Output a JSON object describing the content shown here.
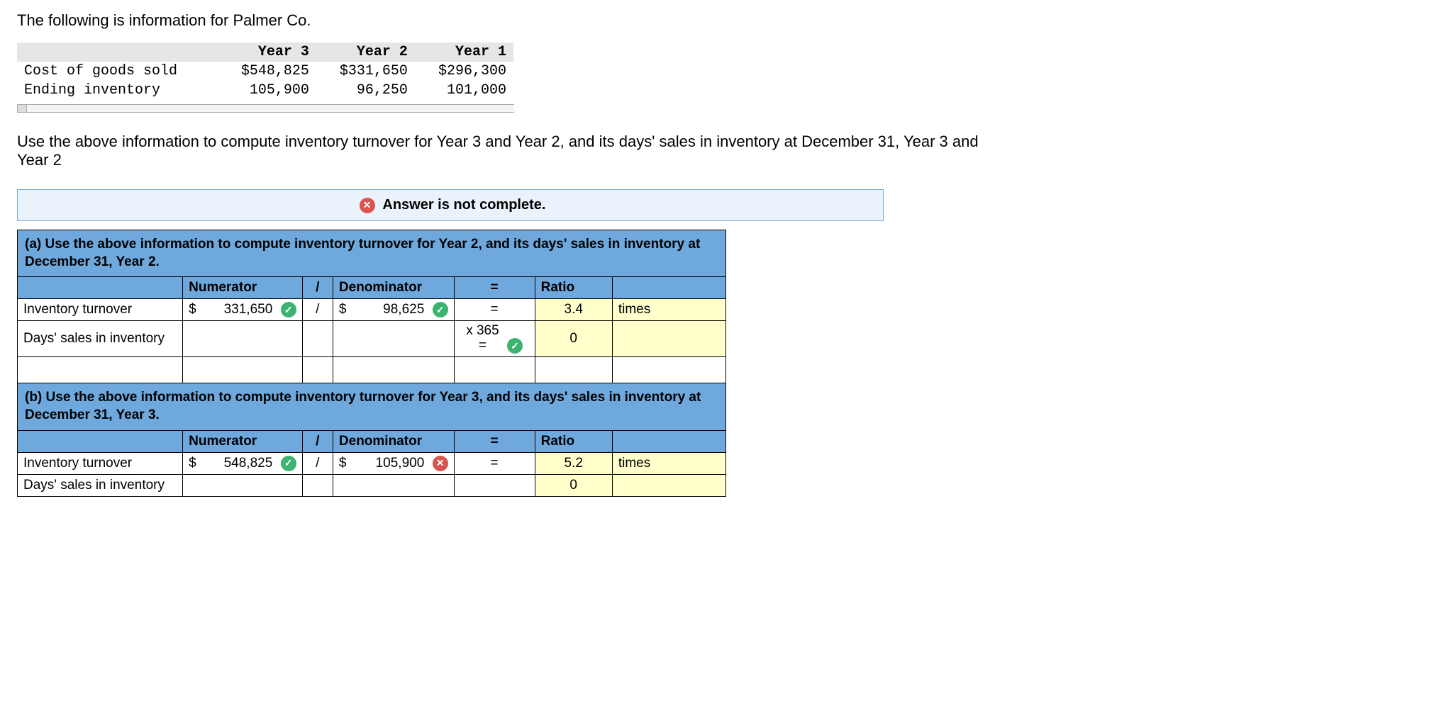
{
  "intro": "The following is information for Palmer Co.",
  "data_table": {
    "headers": [
      "",
      "Year 3",
      "Year 2",
      "Year 1"
    ],
    "rows": [
      {
        "label": "Cost of goods sold",
        "y3": "$548,825",
        "y2": "$331,650",
        "y1": "$296,300"
      },
      {
        "label": "Ending inventory",
        "y3": "105,900",
        "y2": "96,250",
        "y1": "101,000"
      }
    ]
  },
  "question": "Use the above information to compute inventory turnover for Year 3 and Year 2, and its days' sales in inventory at December 31, Year 3 and Year 2",
  "status": "Answer is not complete.",
  "col_headers": {
    "numerator": "Numerator",
    "slash": "/",
    "denominator": "Denominator",
    "equals": "=",
    "ratio": "Ratio"
  },
  "part_a": {
    "title": "(a) Use the above information to compute inventory turnover for Year 2, and its days' sales in inventory at December 31, Year 2.",
    "inv_turnover": {
      "label": "Inventory turnover",
      "numerator": "331,650",
      "numerator_status": "correct",
      "slash": "/",
      "denominator": "98,625",
      "denominator_status": "correct",
      "equals": "=",
      "ratio": "3.4",
      "unit": "times"
    },
    "days_sales": {
      "label": "Days' sales in inventory",
      "eq_top": "x 365",
      "eq_bottom": "=",
      "eq_status": "correct",
      "ratio": "0"
    }
  },
  "part_b": {
    "title": "(b) Use the above information to compute inventory turnover for Year 3, and its days' sales in inventory at December 31, Year 3.",
    "inv_turnover": {
      "label": "Inventory turnover",
      "numerator": "548,825",
      "numerator_status": "correct",
      "slash": "/",
      "denominator": "105,900",
      "denominator_status": "incorrect",
      "equals": "=",
      "ratio": "5.2",
      "unit": "times"
    },
    "days_sales": {
      "label": "Days' sales in inventory",
      "ratio": "0"
    }
  }
}
